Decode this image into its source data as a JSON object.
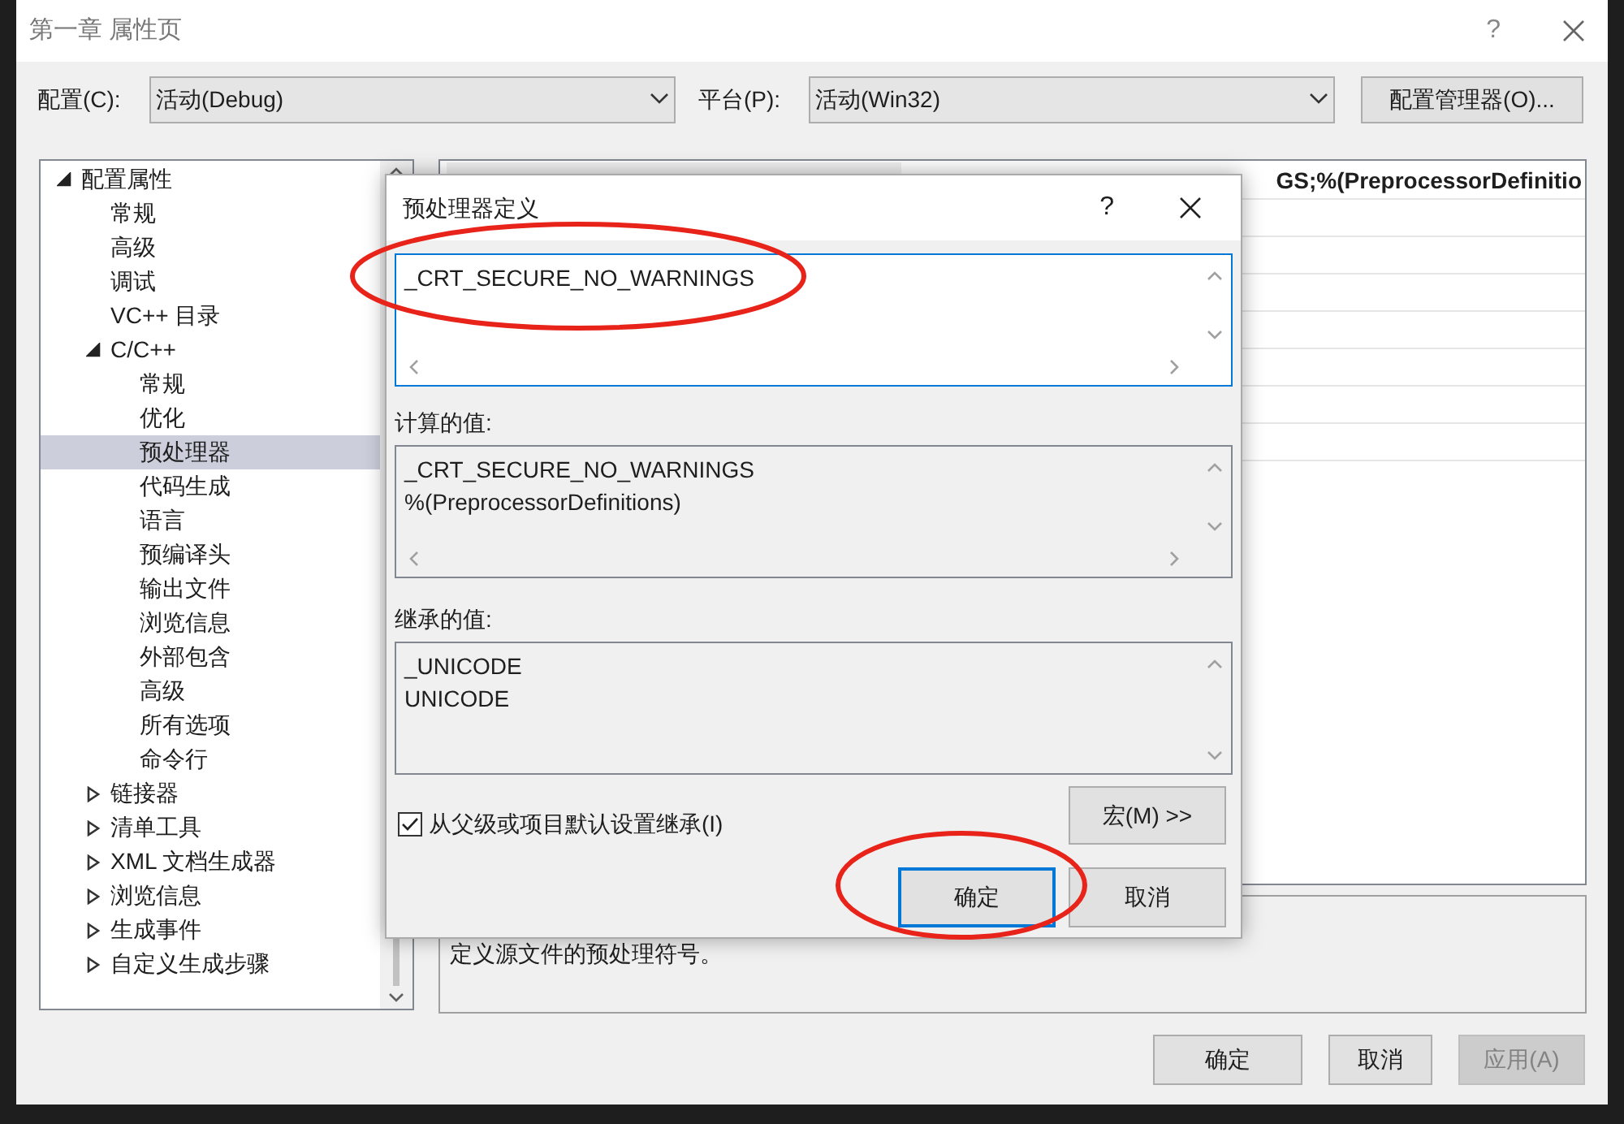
{
  "window": {
    "title": "第一章 属性页",
    "help": "?"
  },
  "config": {
    "configuration_label": "配置(C):",
    "configuration_value": "活动(Debug)",
    "platform_label": "平台(P):",
    "platform_value": "活动(Win32)",
    "manager_button": "配置管理器(O)..."
  },
  "tree": {
    "items": [
      {
        "label": "配置属性",
        "expanded": true,
        "selected": false,
        "children": [
          {
            "label": "常规",
            "selected": false
          },
          {
            "label": "高级",
            "selected": false
          },
          {
            "label": "调试",
            "selected": false
          },
          {
            "label": "VC++ 目录",
            "selected": false
          },
          {
            "label": "C/C++",
            "expanded": true,
            "selected": false,
            "children": [
              {
                "label": "常规",
                "selected": false
              },
              {
                "label": "优化",
                "selected": false
              },
              {
                "label": "预处理器",
                "selected": true
              },
              {
                "label": "代码生成",
                "selected": false
              },
              {
                "label": "语言",
                "selected": false
              },
              {
                "label": "预编译头",
                "selected": false
              },
              {
                "label": "输出文件",
                "selected": false
              },
              {
                "label": "浏览信息",
                "selected": false
              },
              {
                "label": "外部包含",
                "selected": false
              },
              {
                "label": "高级",
                "selected": false
              },
              {
                "label": "所有选项",
                "selected": false
              },
              {
                "label": "命令行",
                "selected": false
              }
            ]
          },
          {
            "label": "链接器",
            "expanded": false,
            "selected": false
          },
          {
            "label": "清单工具",
            "expanded": false,
            "selected": false
          },
          {
            "label": "XML 文档生成器",
            "expanded": false,
            "selected": false
          },
          {
            "label": "浏览信息",
            "expanded": false,
            "selected": false
          },
          {
            "label": "生成事件",
            "expanded": false,
            "selected": false
          },
          {
            "label": "自定义生成步骤",
            "expanded": false,
            "selected": false
          }
        ]
      }
    ]
  },
  "property_grid": {
    "rows": [
      {
        "value": "GS;%(PreprocessorDefinitio"
      }
    ]
  },
  "description": "定义源文件的预处理符号。",
  "buttons": [
    {
      "label": "确定",
      "disabled": false
    },
    {
      "label": "取消",
      "disabled": false
    },
    {
      "label": "应用(A)",
      "disabled": true
    }
  ],
  "dialog": {
    "title": "预处理器定义",
    "help": "?",
    "definitions": "_CRT_SECURE_NO_WARNINGS",
    "computed_label": "计算的值:",
    "computed_lines": [
      "_CRT_SECURE_NO_WARNINGS",
      "%(PreprocessorDefinitions)"
    ],
    "inherited_label": "继承的值:",
    "inherited_lines": [
      "_UNICODE",
      "UNICODE"
    ],
    "inherit_checkbox": {
      "label": "从父级或项目默认设置继承(I)",
      "checked": true
    },
    "macros_button": "宏(M) >>",
    "buttons": [
      {
        "label": "确定",
        "default": true
      },
      {
        "label": "取消",
        "default": false
      }
    ]
  }
}
